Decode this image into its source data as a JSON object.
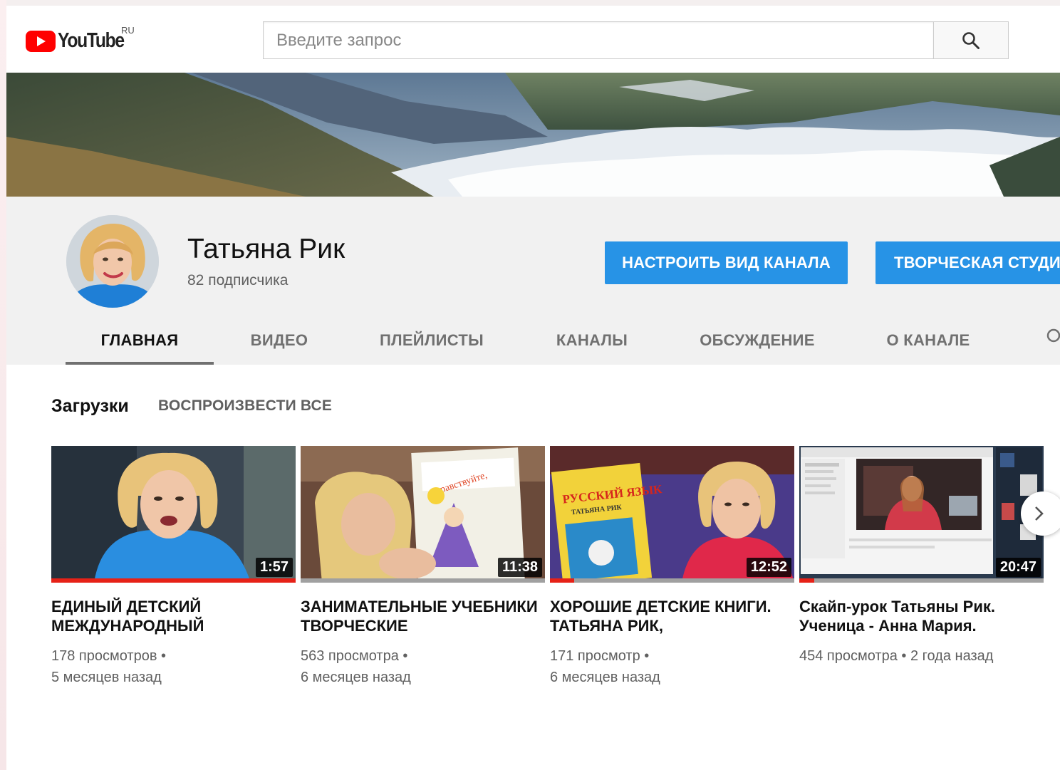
{
  "masthead": {
    "logo_text": "YouTube",
    "region": "RU",
    "search_placeholder": "Введите запрос",
    "search_icon": "search-icon"
  },
  "channel": {
    "name": "Татьяна Рик",
    "subscribers": "82 подписчика",
    "customize_label": "НАСТРОИТЬ ВИД КАНАЛА",
    "studio_label": "ТВОРЧЕСКАЯ СТУДИЯ"
  },
  "tabs": [
    {
      "label": "ГЛАВНАЯ",
      "active": true
    },
    {
      "label": "ВИДЕО",
      "active": false
    },
    {
      "label": "ПЛЕЙЛИСТЫ",
      "active": false
    },
    {
      "label": "КАНАЛЫ",
      "active": false
    },
    {
      "label": "ОБСУЖДЕНИЕ",
      "active": false
    },
    {
      "label": "О КАНАЛЕ",
      "active": false
    }
  ],
  "shelf": {
    "title": "Загрузки",
    "play_all": "ВОСПРОИЗВЕСТИ ВСЕ"
  },
  "videos": [
    {
      "title": "ЕДИНЫЙ ДЕТСКИЙ МЕЖДУНАРОДНЫЙ",
      "duration": "1:57",
      "meta_line1": "178 просмотров •",
      "meta_line2": "5 месяцев назад",
      "progress": 1.0
    },
    {
      "title": "ЗАНИМАТЕЛЬНЫЕ УЧЕБНИКИ ТВОРЧЕСКИЕ",
      "duration": "11:38",
      "meta_line1": "563 просмотра •",
      "meta_line2": "6 месяцев назад",
      "progress": 0.0
    },
    {
      "title": "ХОРОШИЕ ДЕТСКИЕ КНИГИ. ТАТЬЯНА РИК,",
      "duration": "12:52",
      "meta_line1": "171 просмотр •",
      "meta_line2": "6 месяцев назад",
      "progress": 0.1
    },
    {
      "title": "Скайп-урок Татьяны Рик. Ученица - Анна Мария.",
      "duration": "20:47",
      "meta_line1": "454 просмотра • 2 года назад",
      "meta_line2": "",
      "progress": 0.06
    }
  ],
  "colors": {
    "accent_blue": "#2793e6",
    "youtube_red": "#ff0000",
    "progress_red": "#e62117"
  }
}
